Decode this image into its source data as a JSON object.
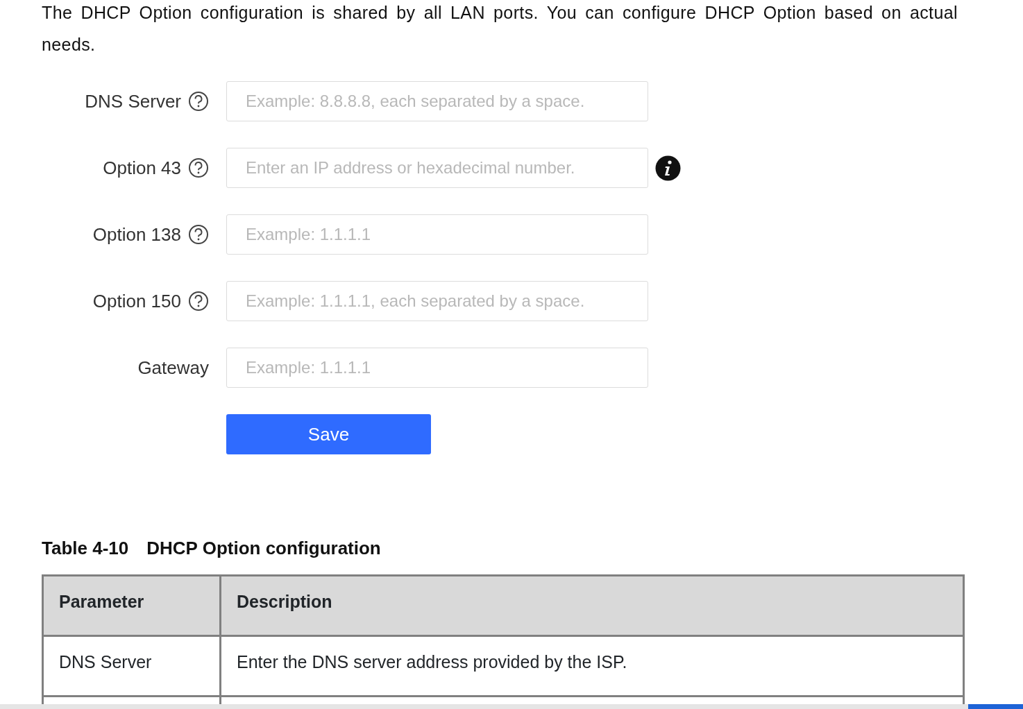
{
  "intro": "The DHCP Option configuration is shared by all LAN ports. You can configure DHCP Option based on actual needs.",
  "form": {
    "fields": [
      {
        "label": "DNS Server",
        "help": true,
        "info": false,
        "placeholder": "Example: 8.8.8.8, each separated by a space."
      },
      {
        "label": "Option 43",
        "help": true,
        "info": true,
        "placeholder": "Enter an IP address or hexadecimal number."
      },
      {
        "label": "Option 138",
        "help": true,
        "info": false,
        "placeholder": "Example: 1.1.1.1"
      },
      {
        "label": "Option 150",
        "help": true,
        "info": false,
        "placeholder": "Example: 1.1.1.1, each separated by a space."
      },
      {
        "label": "Gateway",
        "help": false,
        "info": false,
        "placeholder": "Example: 1.1.1.1"
      }
    ],
    "save_button": "Save"
  },
  "table": {
    "caption_number": "Table 4-10",
    "caption_title": "DHCP Option configuration",
    "columns": [
      "Parameter",
      "Description"
    ],
    "rows": [
      [
        "DNS Server",
        "Enter the DNS server address provided by the ISP."
      ]
    ]
  }
}
